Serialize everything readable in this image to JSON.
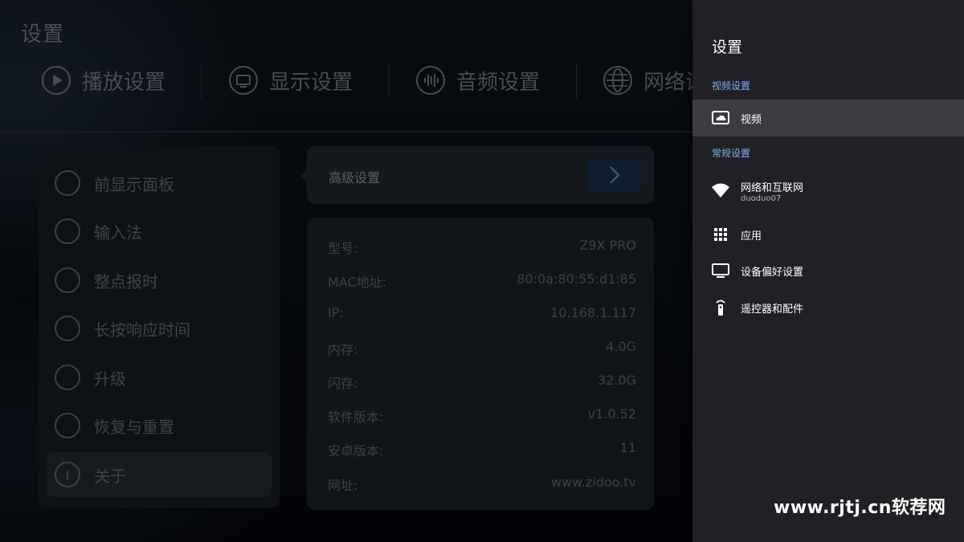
{
  "background": {
    "title": "设置",
    "tabs": [
      {
        "label": "播放设置",
        "icon": "play-circle-icon"
      },
      {
        "label": "显示设置",
        "icon": "monitor-icon"
      },
      {
        "label": "音频设置",
        "icon": "audio-wave-icon"
      },
      {
        "label": "网络设置",
        "icon": "globe-icon"
      }
    ],
    "menu": [
      {
        "label": "前显示面板",
        "icon": "front-panel-icon"
      },
      {
        "label": "输入法",
        "icon": "keyboard-icon"
      },
      {
        "label": "整点报时",
        "icon": "clock-icon"
      },
      {
        "label": "长按响应时间",
        "icon": "pulse-icon"
      },
      {
        "label": "升级",
        "icon": "rocket-icon"
      },
      {
        "label": "恢复与重置",
        "icon": "wrench-icon"
      },
      {
        "label": "关于",
        "icon": "info-icon"
      }
    ],
    "advanced": {
      "label": "高级设置"
    },
    "info": [
      {
        "key": "型号:",
        "value": "Z9X PRO"
      },
      {
        "key": "MAC地址:",
        "value": "80:0a:80:55:d1:85"
      },
      {
        "key": "IP:",
        "value": "10.168.1.117"
      },
      {
        "key": "内存:",
        "value": "4.0G"
      },
      {
        "key": "闪存:",
        "value": "32.0G"
      },
      {
        "key": "软件版本:",
        "value": "v1.0.52"
      },
      {
        "key": "安卓版本:",
        "value": "11"
      },
      {
        "key": "网址:",
        "value": "www.zidoo.tv"
      }
    ]
  },
  "panel": {
    "title": "设置",
    "sections": [
      {
        "label": "视频设置"
      },
      {
        "label": "常规设置"
      }
    ],
    "items": [
      {
        "label": "视频",
        "icon": "video-cloud-icon"
      },
      {
        "label": "网络和互联网",
        "sub": "duoduo07",
        "icon": "wifi-icon"
      },
      {
        "label": "应用",
        "icon": "apps-grid-icon"
      },
      {
        "label": "设备偏好设置",
        "icon": "tv-icon"
      },
      {
        "label": "遥控器和配件",
        "icon": "remote-icon"
      }
    ]
  },
  "watermark": "www.rjtj.cn软荐网",
  "colors": {
    "panel_bg": "#202124",
    "selected_bg": "#3c3d40",
    "section_accent": "#7fb0f5",
    "advanced_button": "#11233a"
  }
}
